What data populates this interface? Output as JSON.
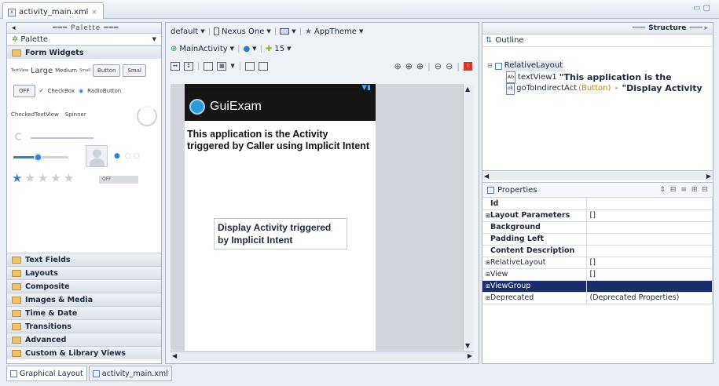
{
  "file_tab": {
    "title": "activity_main.xml"
  },
  "palette": {
    "header": "Palette",
    "dropdown_label": "Palette",
    "form_widgets_label": "Form Widgets",
    "widget_row1": {
      "textview": "TextView",
      "large": "Large",
      "medium": "Medium",
      "small": "Small",
      "button": "Button",
      "small_button": "Smal"
    },
    "widget_row2": {
      "toggle": "OFF",
      "checkbox": "CheckBox",
      "radio": "RadioButton"
    },
    "widget_row3": {
      "checked": "CheckedTextView",
      "spinner": "Spinner"
    },
    "switch_label": "OFF",
    "rating_stars": 1,
    "categories": [
      "Text Fields",
      "Layouts",
      "Composite",
      "Images & Media",
      "Time & Date",
      "Transitions",
      "Advanced",
      "Custom & Library Views"
    ]
  },
  "editor": {
    "toolbar1": {
      "config": "default",
      "device": "Nexus One",
      "theme": "AppTheme"
    },
    "toolbar2": {
      "activity": "MainActivity",
      "api": "15"
    },
    "app_title": "GuiExam",
    "text_view": "This application is the Activity triggered by Caller  using Implicit Intent",
    "button_text": "Display Activity triggered by Implicit Intent"
  },
  "structure": {
    "header": "Structure",
    "outline_title": "Outline",
    "tree": {
      "root": "RelativeLayout",
      "child1_id": "textView1",
      "child1_text": "\"This application is the",
      "child2_id": "goToIndirectAct",
      "child2_type": "(Button)",
      "child2_dash": " - ",
      "child2_text": "\"Display Activity"
    }
  },
  "properties": {
    "title": "Properties",
    "rows": [
      {
        "name": "Id",
        "value": "",
        "type": "bold"
      },
      {
        "name": "Layout Parameters",
        "value": "[]",
        "type": "bold"
      },
      {
        "name": "Background",
        "value": "",
        "type": "bold"
      },
      {
        "name": "Padding Left",
        "value": "",
        "type": "bold"
      },
      {
        "name": "Content Description",
        "value": "",
        "type": "bold"
      },
      {
        "name": "RelativeLayout",
        "value": "[]",
        "type": "plain"
      },
      {
        "name": "View",
        "value": "[]",
        "type": "plain"
      },
      {
        "name": "ViewGroup",
        "value": "",
        "type": "selected"
      },
      {
        "name": "Deprecated",
        "value": "(Deprecated Properties)",
        "type": "plain"
      }
    ]
  },
  "bottom_tabs": [
    "Graphical Layout",
    "activity_main.xml"
  ],
  "colors": {
    "selection": "#1b2d6b",
    "action_bar": "#151515",
    "accent": "#2a9cdb"
  }
}
